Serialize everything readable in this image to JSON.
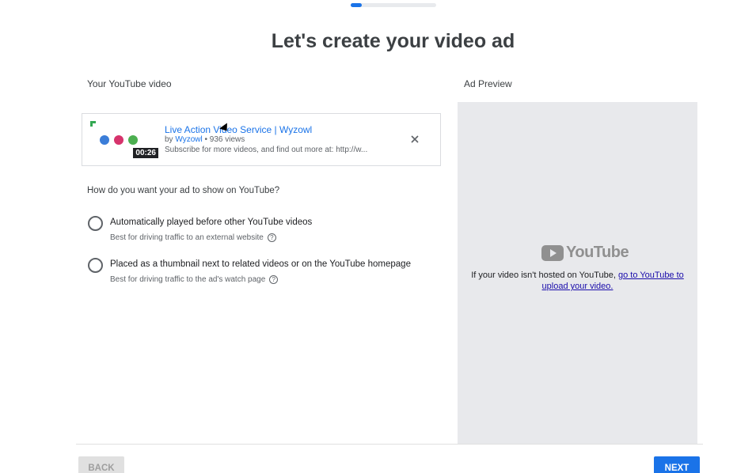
{
  "progress": {
    "percent": 13
  },
  "page_title": "Let's create your video ad",
  "left_section_label": "Your YouTube video",
  "right_section_label": "Ad Preview",
  "video": {
    "title": "Live Action Video Service | Wyzowl",
    "by_prefix": "by",
    "channel": "Wyzowl",
    "views": "• 936 views",
    "description": "Subscribe for more videos, and find out more at: http://w...",
    "duration": "00:26"
  },
  "question": "How do you want your ad to show on YouTube?",
  "options": [
    {
      "label": "Automatically played before other YouTube videos",
      "sub": "Best for driving traffic to an external website",
      "selected": false
    },
    {
      "label": "Placed as a thumbnail next to related videos or on the YouTube homepage",
      "sub": "Best for driving traffic to the ad's watch page",
      "selected": false
    }
  ],
  "preview": {
    "logo_text": "YouTube",
    "message": "If your video isn't hosted on YouTube,",
    "link_text": "go to YouTube to upload your video."
  },
  "buttons": {
    "back": "BACK",
    "next": "NEXT"
  },
  "colors": {
    "accent": "#1a73e8",
    "preview_bg": "#e8e9ec",
    "link": "#1a0dab"
  }
}
